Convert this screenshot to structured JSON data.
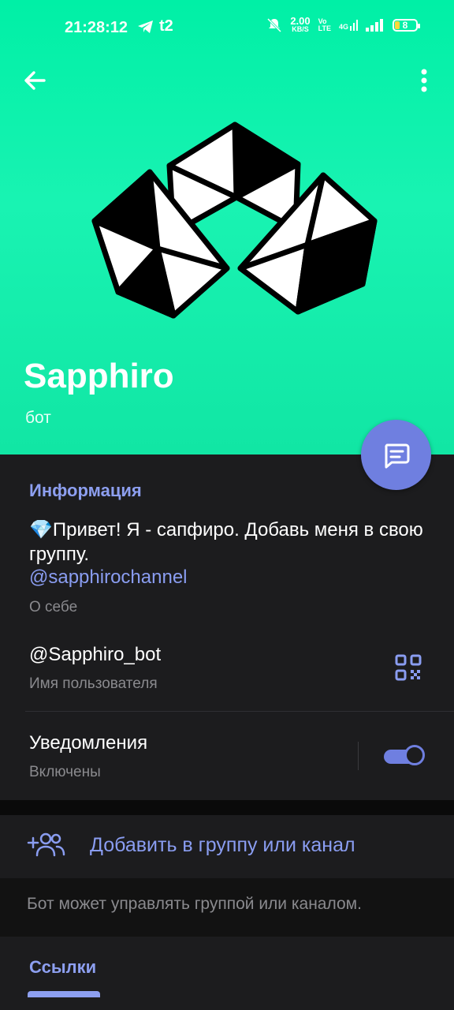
{
  "status_bar": {
    "time": "21:28:12",
    "carrier_badge": "t2",
    "net_speed_value": "2.00",
    "net_speed_unit": "KB/S",
    "volte": "Vo\nLTE",
    "network": "4G",
    "battery": "8"
  },
  "header": {
    "back_icon": "arrow-left-icon",
    "menu_icon": "more-vertical-icon"
  },
  "profile": {
    "name": "Sapphiro",
    "type": "бот"
  },
  "fab": {
    "icon": "message-icon"
  },
  "info": {
    "section_title": "Информация",
    "bio": "💎Привет! Я - сапфиро. Добавь меня в свою группу.",
    "bio_link": "@sapphirochannel",
    "bio_label": "О себе",
    "username": "@Sapphiro_bot",
    "username_label": "Имя пользователя",
    "notifications_title": "Уведомления",
    "notifications_status": "Включены",
    "notifications_enabled": true
  },
  "actions": {
    "add_to_group": "Добавить в группу или канал",
    "add_note": "Бот может управлять группой или каналом."
  },
  "links": {
    "section_title": "Ссылки"
  },
  "colors": {
    "hero": "#00f0a6",
    "accent": "#8a9df1",
    "fab": "#6f7fe0",
    "panel": "#1c1c1e"
  }
}
